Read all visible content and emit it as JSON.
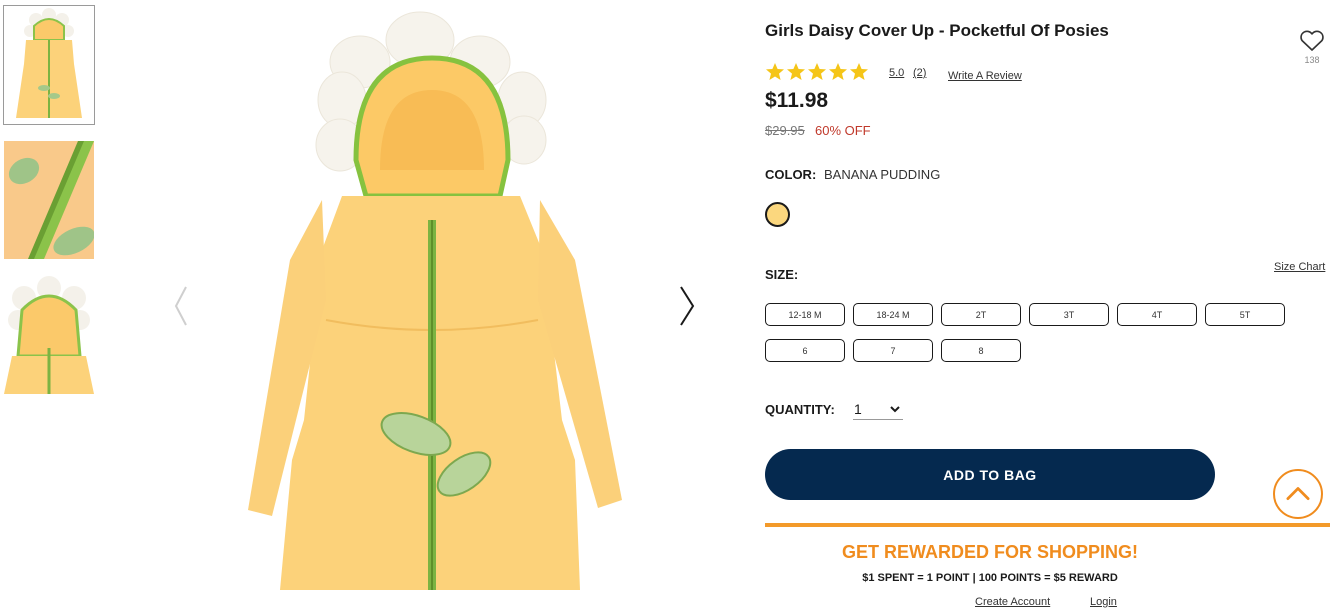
{
  "product": {
    "title": "Girls Daisy Cover Up - Pocketful Of Posies",
    "wishlist_count": "138",
    "rating_value": "5.0",
    "rating_count": "(2)",
    "write_review": "Write A Review",
    "price": "$11.98",
    "original_price": "$29.95",
    "discount": "60% OFF"
  },
  "color": {
    "label": "COLOR:",
    "value": "BANANA PUDDING",
    "swatch_hex": "#fbd77e"
  },
  "size": {
    "label": "SIZE:",
    "chart_link": "Size Chart",
    "options": [
      "12-18 M",
      "18-24 M",
      "2T",
      "3T",
      "4T",
      "5T",
      "6",
      "7",
      "8"
    ]
  },
  "quantity": {
    "label": "QUANTITY:",
    "value": "1"
  },
  "actions": {
    "add_to_bag": "ADD TO BAG"
  },
  "rewards": {
    "title": "GET REWARDED FOR SHOPPING!",
    "subtitle": "$1 SPENT = 1 POINT | 100 POINTS = $5 REWARD",
    "create_account": "Create Account",
    "login": "Login"
  },
  "colors": {
    "accent_orange": "#f08c1e",
    "primary_navy": "#05294f",
    "star_gold": "#f5c518",
    "sale_red": "#c0392b"
  },
  "icons": {
    "wishlist": "heart-icon",
    "star": "star-icon",
    "prev": "chevron-left-icon",
    "next": "chevron-right-icon",
    "qty": "chevron-down-icon",
    "back_to_top": "chevron-up-icon"
  }
}
